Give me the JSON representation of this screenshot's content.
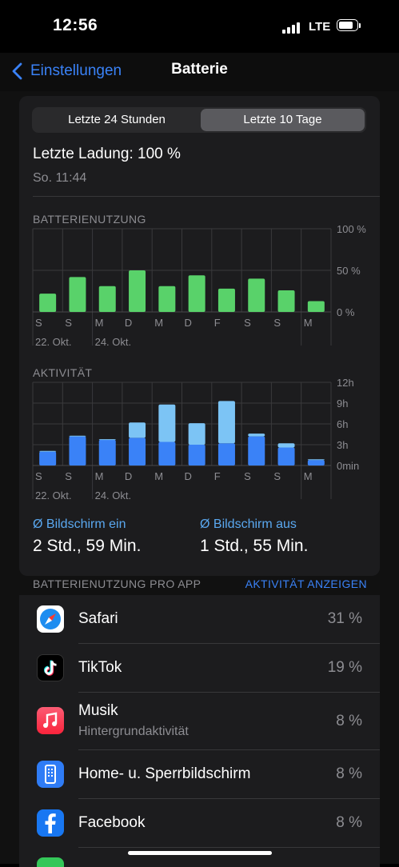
{
  "status": {
    "time": "12:56",
    "network": "LTE"
  },
  "nav": {
    "back_label": "Einstellungen",
    "title": "Batterie"
  },
  "segments": {
    "left": "Letzte 24 Stunden",
    "right": "Letzte 10 Tage",
    "selected": "right"
  },
  "last_charge": {
    "label": "Letzte Ladung: 100 %",
    "time": "So. 11:44"
  },
  "usage_chart": {
    "title": "BATTERIENUTZUNG"
  },
  "activity_chart": {
    "title": "AKTIVITÄT"
  },
  "chart_data": [
    {
      "type": "bar",
      "title": "BATTERIENUTZUNG",
      "categories": [
        "S",
        "S",
        "M",
        "D",
        "M",
        "D",
        "F",
        "S",
        "S",
        "M"
      ],
      "date_labels": [
        "22. Okt.",
        "24. Okt."
      ],
      "y_ticks": [
        "100 %",
        "50 %",
        "0 %"
      ],
      "ylim": [
        0,
        100
      ],
      "series": [
        {
          "values": [
            22,
            42,
            31,
            50,
            31,
            44,
            28,
            40,
            26,
            13
          ]
        }
      ],
      "colors": [
        "#59d26a"
      ]
    },
    {
      "type": "bar",
      "title": "AKTIVITÄT",
      "stacked": true,
      "categories": [
        "S",
        "S",
        "M",
        "D",
        "M",
        "D",
        "F",
        "S",
        "S",
        "M"
      ],
      "date_labels": [
        "22. Okt.",
        "24. Okt."
      ],
      "y_ticks": [
        "12h",
        "9h",
        "6h",
        "3h",
        "0min"
      ],
      "ylim": [
        0,
        12
      ],
      "series": [
        {
          "values": [
            2.0,
            4.2,
            3.7,
            4.0,
            3.4,
            3.0,
            3.2,
            4.2,
            2.6,
            0.8
          ]
        },
        {
          "values": [
            0.1,
            0.1,
            0.1,
            2.2,
            5.4,
            3.1,
            6.1,
            0.4,
            0.6,
            0.1
          ]
        }
      ],
      "colors": [
        "#3a82f7",
        "#7cc4f5"
      ]
    }
  ],
  "screen": {
    "on_label": "Ø Bildschirm ein",
    "on_value": "2 Std., 59 Min.",
    "off_label": "Ø Bildschirm aus",
    "off_value": "1 Std., 55 Min."
  },
  "apps": {
    "header": "BATTERIENUTZUNG PRO APP",
    "action": "AKTIVITÄT ANZEIGEN",
    "items": [
      {
        "name": "Safari",
        "sub": "",
        "pct": "31 %",
        "icon": "safari-icon"
      },
      {
        "name": "TikTok",
        "sub": "",
        "pct": "19 %",
        "icon": "tiktok-icon"
      },
      {
        "name": "Musik",
        "sub": "Hintergrundaktivität",
        "pct": "8 %",
        "icon": "music-icon"
      },
      {
        "name": "Home- u. Sperrbildschirm",
        "sub": "",
        "pct": "8 %",
        "icon": "home-screen-icon"
      },
      {
        "name": "Facebook",
        "sub": "",
        "pct": "8 %",
        "icon": "facebook-icon"
      }
    ]
  }
}
